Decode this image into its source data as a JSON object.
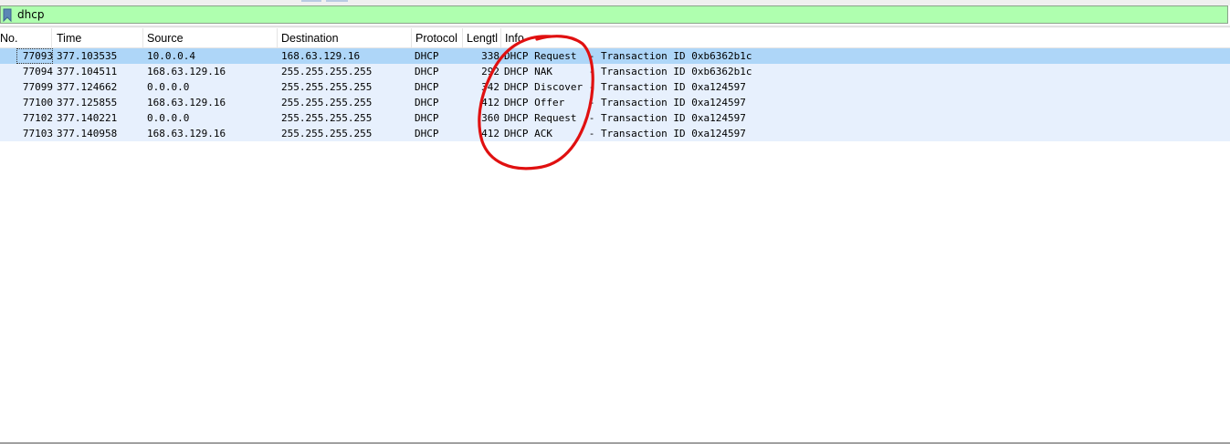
{
  "filter": {
    "value": "dhcp"
  },
  "columns": [
    "No.",
    "Time",
    "Source",
    "Destination",
    "Protocol",
    "Lengtl",
    "Info"
  ],
  "packets": [
    {
      "no": "77093",
      "time": "377.103535",
      "source": "10.0.0.4",
      "destination": "168.63.129.16",
      "protocol": "DHCP",
      "length": "338",
      "info": "DHCP Request  - Transaction ID 0xb6362b1c"
    },
    {
      "no": "77094",
      "time": "377.104511",
      "source": "168.63.129.16",
      "destination": "255.255.255.255",
      "protocol": "DHCP",
      "length": "292",
      "info": "DHCP NAK      - Transaction ID 0xb6362b1c"
    },
    {
      "no": "77099",
      "time": "377.124662",
      "source": "0.0.0.0",
      "destination": "255.255.255.255",
      "protocol": "DHCP",
      "length": "342",
      "info": "DHCP Discover - Transaction ID 0xa124597"
    },
    {
      "no": "77100",
      "time": "377.125855",
      "source": "168.63.129.16",
      "destination": "255.255.255.255",
      "protocol": "DHCP",
      "length": "412",
      "info": "DHCP Offer    - Transaction ID 0xa124597"
    },
    {
      "no": "77102",
      "time": "377.140221",
      "source": "0.0.0.0",
      "destination": "255.255.255.255",
      "protocol": "DHCP",
      "length": "360",
      "info": "DHCP Request  - Transaction ID 0xa124597"
    },
    {
      "no": "77103",
      "time": "377.140958",
      "source": "168.63.129.16",
      "destination": "255.255.255.255",
      "protocol": "DHCP",
      "length": "412",
      "info": "DHCP ACK      - Transaction ID 0xa124597"
    }
  ],
  "selected_row": 0,
  "colors": {
    "filter_bg": "#afffaf",
    "row_bg": "#e7f0fd",
    "selected_bg": "#aed6f8",
    "annotation": "#e01010"
  }
}
